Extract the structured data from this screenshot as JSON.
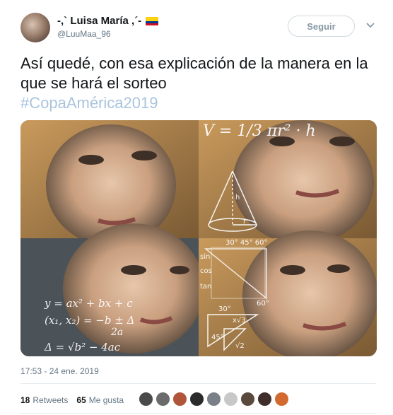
{
  "tweet": {
    "display_name": "-,` Luisa María ,´-",
    "handle": "@LuuMaa_96",
    "follow_label": "Seguir",
    "text": "Así quedé, con esa explicación de la manera en la que se hará el sorteo",
    "hashtag": "#CopaAmérica2019",
    "timestamp": "17:53 - 24 ene. 2019",
    "retweets_count": "18",
    "retweets_label": "Retweets",
    "likes_count": "65",
    "likes_label": "Me gusta"
  },
  "meme_math": {
    "formula_volume": "V = 1/3 πr² · h",
    "frac_num": "1",
    "frac_den": "3",
    "cone_h": "h",
    "cone_r": "r",
    "trig_angles": "30°  45°  60°",
    "sin": "sin",
    "cos": "cos",
    "tan": "tan",
    "quad": "y = ax² + bx + c",
    "roots": "(x₁, x₂) = −b ± Δ",
    "roots_den": "2a",
    "delta": "Δ = √b² − 4ac",
    "tri_60": "60°",
    "tri_30": "30°",
    "tri_45": "45°",
    "tri_root3": "x√3",
    "tri_root2": "√2"
  },
  "colors": {
    "flag_yellow": "#FCD116",
    "flag_blue": "#003893",
    "flag_red": "#CE1126",
    "hashtag": "#a9c4dd"
  },
  "icons": {
    "caret": "chevron-down-icon"
  }
}
